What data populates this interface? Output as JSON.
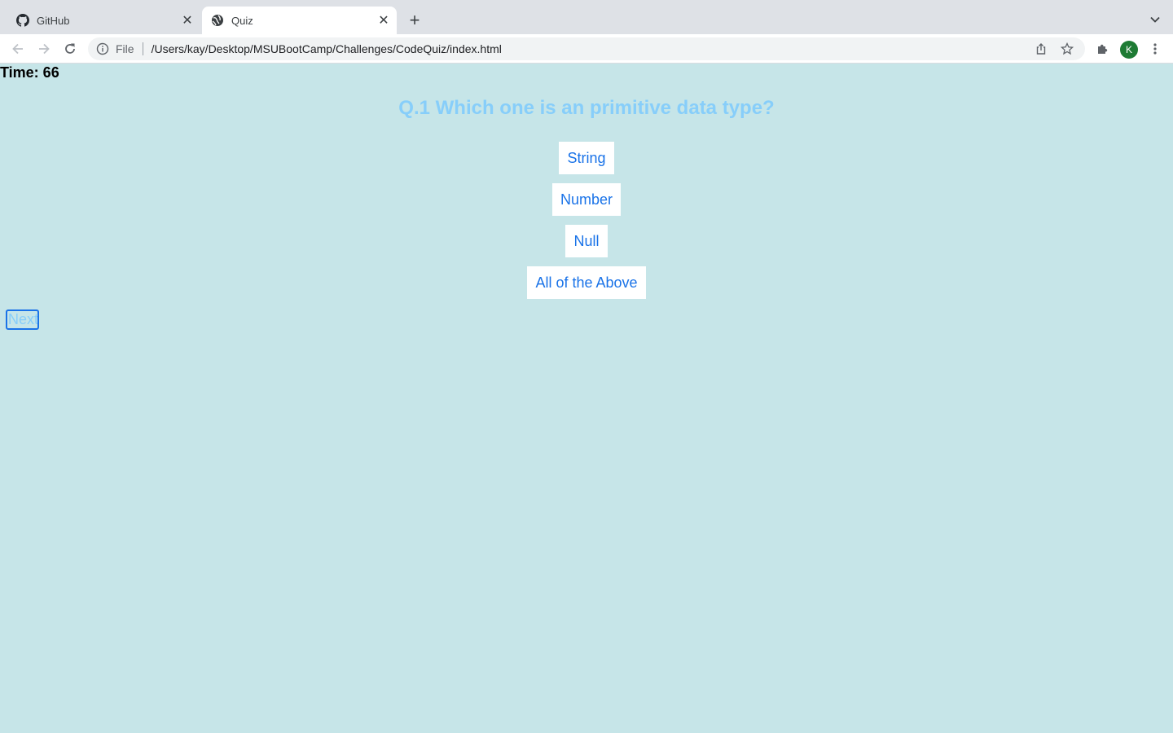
{
  "browser": {
    "tabs": [
      {
        "title": "GitHub",
        "icon": "github-icon",
        "active": false
      },
      {
        "title": "Quiz",
        "icon": "globe-icon",
        "active": true
      }
    ],
    "address": {
      "scheme": "File",
      "url": "/Users/kay/Desktop/MSUBootCamp/Challenges/CodeQuiz/index.html"
    },
    "profile_initial": "K",
    "colors": {
      "page_background": "#c6e5e8",
      "question_text": "#87cefa",
      "answer_text": "#1a73e8",
      "avatar": "#1e7b34"
    }
  },
  "quiz": {
    "timer": "Time: 66",
    "question": "Q.1 Which one is an primitive data type?",
    "answers": [
      "String",
      "Number",
      "Null",
      "All of the Above"
    ],
    "next_label": "Next"
  }
}
